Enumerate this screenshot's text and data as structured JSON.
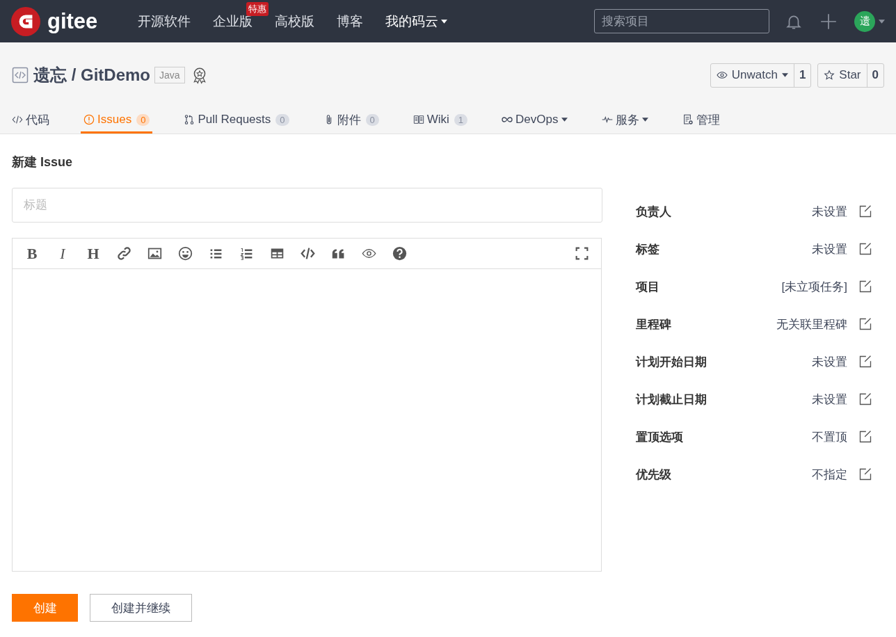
{
  "topnav": {
    "logo": "gitee",
    "links": [
      {
        "label": "开源软件",
        "caret": false
      },
      {
        "label": "企业版",
        "badge": "特惠",
        "caret": false
      },
      {
        "label": "高校版",
        "caret": false
      },
      {
        "label": "博客",
        "caret": false
      },
      {
        "label": "我的码云",
        "caret": true
      }
    ],
    "search": {
      "placeholder": "搜索项目"
    },
    "avatar": "遗"
  },
  "repo": {
    "owner": "遗忘",
    "separator": "/",
    "name": "GitDemo",
    "language": "Java",
    "watch": {
      "label": "Unwatch",
      "count": "1"
    },
    "star": {
      "label": "Star",
      "count": "0"
    }
  },
  "tabs": [
    {
      "label": "代码",
      "caret": false,
      "selected": false
    },
    {
      "label": "Issues",
      "count": "0",
      "caret": false,
      "selected": true
    },
    {
      "label": "Pull Requests",
      "count": "0",
      "caret": false,
      "selected": false
    },
    {
      "label": "附件",
      "count": "0",
      "caret": false,
      "selected": false
    },
    {
      "label": "Wiki",
      "count": "1",
      "caret": false,
      "selected": false
    },
    {
      "label": "DevOps",
      "caret": true,
      "selected": false
    },
    {
      "label": "服务",
      "caret": true,
      "selected": false
    },
    {
      "label": "管理",
      "caret": false,
      "selected": false
    }
  ],
  "page_title": "新建 Issue",
  "title_field": {
    "placeholder": "标题"
  },
  "toolbar": [
    {
      "kind": "bold",
      "text": "B"
    },
    {
      "kind": "italic",
      "text": "I"
    },
    {
      "kind": "heading",
      "text": "H"
    },
    {
      "kind": "link"
    },
    {
      "kind": "image"
    },
    {
      "kind": "emoji"
    },
    {
      "kind": "ul"
    },
    {
      "kind": "ol"
    },
    {
      "kind": "table"
    },
    {
      "kind": "code"
    },
    {
      "kind": "quote"
    },
    {
      "kind": "preview"
    },
    {
      "kind": "help"
    },
    {
      "kind": "fullscreen"
    }
  ],
  "fields": [
    {
      "label": "负责人",
      "value": "未设置"
    },
    {
      "label": "标签",
      "value": "未设置"
    },
    {
      "label": "项目",
      "value": "[未立项任务]"
    },
    {
      "label": "里程碑",
      "value": "无关联里程碑"
    },
    {
      "label": "计划开始日期",
      "value": "未设置"
    },
    {
      "label": "计划截止日期",
      "value": "未设置"
    },
    {
      "label": "置顶选项",
      "value": "不置顶"
    },
    {
      "label": "优先级",
      "value": "不指定"
    }
  ],
  "buttons": [
    {
      "kind": "primary",
      "label": "创建"
    },
    {
      "kind": "default",
      "label": "创建并继续"
    }
  ]
}
